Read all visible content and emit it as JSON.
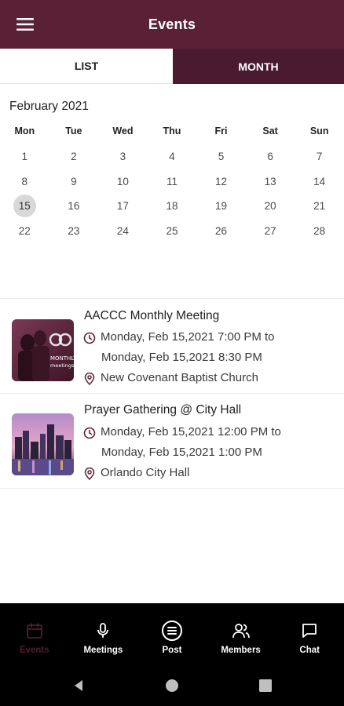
{
  "header": {
    "title": "Events",
    "menu_icon": "hamburger-menu-icon"
  },
  "tabs": [
    {
      "label": "LIST",
      "active": false
    },
    {
      "label": "MONTH",
      "active": true
    }
  ],
  "calendar": {
    "month_label": "February 2021",
    "weekdays": [
      "Mon",
      "Tue",
      "Wed",
      "Thu",
      "Fri",
      "Sat",
      "Sun"
    ],
    "weeks": [
      [
        "1",
        "2",
        "3",
        "4",
        "5",
        "6",
        "7"
      ],
      [
        "8",
        "9",
        "10",
        "11",
        "12",
        "13",
        "14"
      ],
      [
        "15",
        "16",
        "17",
        "18",
        "19",
        "20",
        "21"
      ],
      [
        "22",
        "23",
        "24",
        "25",
        "26",
        "27",
        "28"
      ]
    ],
    "selected_day": "15"
  },
  "events": [
    {
      "title": "AACCC Monthly Meeting",
      "time_line1": "Monday, Feb 15,2021 7:00 PM to",
      "time_line2": "Monday, Feb 15,2021 8:30 PM",
      "location": "New Covenant Baptist Church",
      "thumb_text1": "MONTHLY",
      "thumb_text2": "meetings"
    },
    {
      "title": "Prayer Gathering @ City Hall",
      "time_line1": "Monday, Feb 15,2021 12:00 PM to",
      "time_line2": "Monday, Feb 15,2021 1:00 PM",
      "location": "Orlando City Hall"
    }
  ],
  "bottom_nav": [
    {
      "label": "Events",
      "icon": "calendar-icon",
      "active": true
    },
    {
      "label": "Meetings",
      "icon": "microphone-icon",
      "active": false
    },
    {
      "label": "Post",
      "icon": "post-list-icon",
      "active": false
    },
    {
      "label": "Members",
      "icon": "members-icon",
      "active": false
    },
    {
      "label": "Chat",
      "icon": "chat-bubble-icon",
      "active": false
    }
  ],
  "colors": {
    "header_bg": "#5a2136",
    "active_tab_bg": "#4a1a2e",
    "active_nav": "#4e1e30",
    "selected_day_bg": "#d8d8d8"
  }
}
